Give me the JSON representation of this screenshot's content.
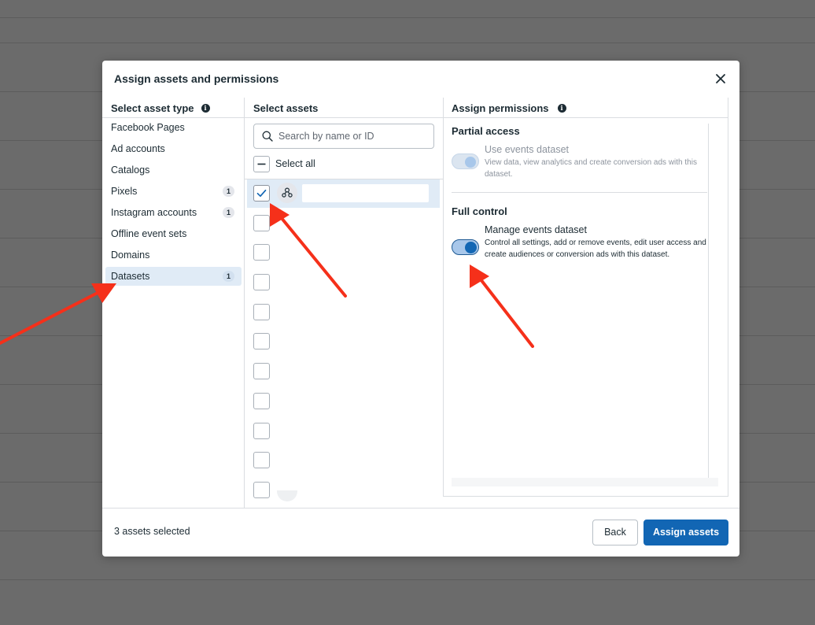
{
  "dialog": {
    "title": "Assign assets and permissions",
    "close_icon": "close-icon"
  },
  "asset_types": {
    "header": "Select asset type",
    "items": [
      {
        "label": "Facebook Pages",
        "count": null
      },
      {
        "label": "Ad accounts",
        "count": null
      },
      {
        "label": "Catalogs",
        "count": null
      },
      {
        "label": "Pixels",
        "count": "1"
      },
      {
        "label": "Instagram accounts",
        "count": "1"
      },
      {
        "label": "Offline event sets",
        "count": null
      },
      {
        "label": "Domains",
        "count": null
      },
      {
        "label": "Datasets",
        "count": "1",
        "selected": true
      }
    ]
  },
  "assets": {
    "header": "Select assets",
    "search_placeholder": "Search by name or ID",
    "select_all_label": "Select all",
    "rows_checked": [
      true,
      false,
      false,
      false,
      false,
      false,
      false,
      false,
      false,
      false,
      false
    ]
  },
  "permissions": {
    "header": "Assign permissions",
    "partial": {
      "section_title": "Partial access",
      "title": "Use events dataset",
      "description": "View data, view analytics and create conversion ads with this dataset.",
      "enabled": true,
      "disabled": true
    },
    "full": {
      "section_title": "Full control",
      "title": "Manage events dataset",
      "description": "Control all settings, add or remove events, edit user access and create audiences or conversion ads with this dataset.",
      "enabled": true
    }
  },
  "footer": {
    "status": "3 assets selected",
    "back_label": "Back",
    "assign_label": "Assign assets"
  },
  "colors": {
    "primary": "#1266b4",
    "selected_bg": "#e0ebf6",
    "annotation_arrow": "#f5301a"
  }
}
